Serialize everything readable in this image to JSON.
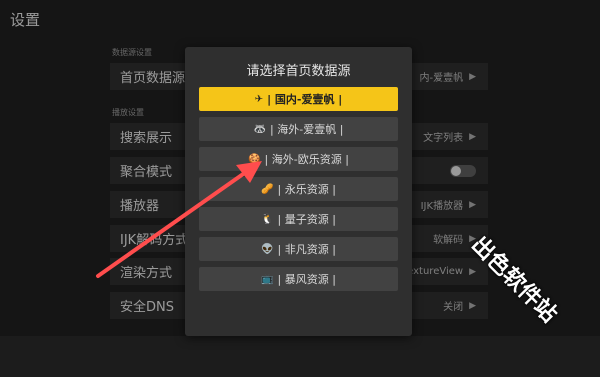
{
  "title": "设置",
  "sections": {
    "homepage": "数据源设置",
    "playback": "播放设置"
  },
  "rows": [
    {
      "label": "首页数据源",
      "value": "内-爱壹帆",
      "type": "arrow"
    },
    {
      "label": "搜索展示",
      "value": "文字列表",
      "type": "arrow"
    },
    {
      "label": "聚合模式",
      "value": "",
      "type": "toggle"
    },
    {
      "label": "播放器",
      "value": "IJK播放器",
      "type": "arrow"
    },
    {
      "label": "IJK解码方式",
      "value": "软解码",
      "type": "arrow"
    },
    {
      "label": "渲染方式",
      "value": "TextureView",
      "type": "arrow"
    },
    {
      "label": "安全DNS",
      "value": "关闭",
      "type": "arrow"
    }
  ],
  "dialog": {
    "title": "请选择首页数据源",
    "options": [
      {
        "icon": "plane-icon",
        "glyph": "✈",
        "label": "| 国内-爱壹帆 |",
        "selected": true
      },
      {
        "icon": "raccoon-icon",
        "glyph": "🦝",
        "label": "| 海外-爱壹帆 |",
        "selected": false
      },
      {
        "icon": "cookie-icon",
        "glyph": "🍪",
        "label": "| 海外-欧乐资源 |",
        "selected": false
      },
      {
        "icon": "peanut-icon",
        "glyph": "🥜",
        "label": "| 永乐资源 |",
        "selected": false
      },
      {
        "icon": "penguin-icon",
        "glyph": "🐧",
        "label": "| 量子资源 |",
        "selected": false
      },
      {
        "icon": "alien-icon",
        "glyph": "👽",
        "label": "| 非凡资源 |",
        "selected": false
      },
      {
        "icon": "tv-icon",
        "glyph": "📺",
        "label": "| 暴风资源 |",
        "selected": false
      }
    ]
  },
  "watermark": "出色软件站",
  "colors": {
    "accent": "#f5c518",
    "annotation_arrow": "#ff4d4d"
  }
}
